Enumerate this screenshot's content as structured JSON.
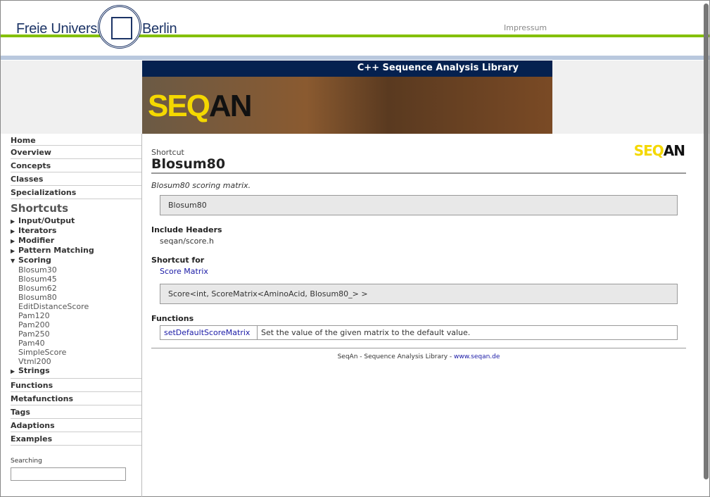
{
  "header": {
    "uni_left": "Freie Universität",
    "uni_right": "Berlin",
    "impressum": "Impressum",
    "banner_title": "C++ Sequence Analysis Library",
    "logo_a": "SEQ",
    "logo_b": "AN"
  },
  "sidebar": {
    "nav_top": [
      "Home",
      "Overview",
      "Concepts",
      "Classes",
      "Specializations"
    ],
    "shortcuts_title": "Shortcuts",
    "groups_before": [
      "Input/Output",
      "Iterators",
      "Modifier",
      "Pattern Matching"
    ],
    "open_group": "Scoring",
    "scoring_items": [
      "Blosum30",
      "Blosum45",
      "Blosum62",
      "Blosum80",
      "EditDistanceScore",
      "Pam120",
      "Pam200",
      "Pam250",
      "Pam40",
      "SimpleScore",
      "Vtml200"
    ],
    "groups_after": [
      "Strings"
    ],
    "nav_bottom": [
      "Functions",
      "Metafunctions",
      "Tags",
      "Adaptions",
      "Examples"
    ],
    "search_label": "Searching",
    "search_value": ""
  },
  "main": {
    "kind": "Shortcut",
    "title": "Blosum80",
    "description": "Blosum80 scoring matrix.",
    "signature": "Blosum80",
    "include_heading": "Include Headers",
    "include_value": "seqan/score.h",
    "shortcut_heading": "Shortcut for",
    "shortcut_link": "Score Matrix",
    "shortcut_type": "Score<int, ScoreMatrix<AminoAcid, Blosum80_> >",
    "functions_heading": "Functions",
    "functions": [
      {
        "name": "setDefaultScoreMatrix",
        "desc": "Set the value of the given matrix to the default value."
      }
    ],
    "footer_text": "SeqAn - Sequence Analysis Library - ",
    "footer_link": "www.seqan.de"
  }
}
